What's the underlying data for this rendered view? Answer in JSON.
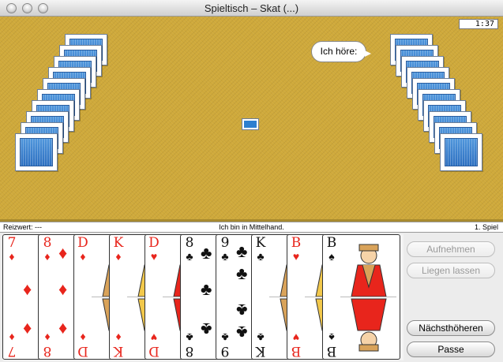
{
  "window": {
    "title": "Spieltisch – Skat (...)"
  },
  "timer": "1:37",
  "speech_bubble": "Ich höre:",
  "status": {
    "left": "Reizwert: ---",
    "center": "Ich bin in Mittelhand.",
    "right": "1. Spiel"
  },
  "hand": [
    {
      "rank": "7",
      "suit": "♦",
      "color": "red"
    },
    {
      "rank": "8",
      "suit": "♦",
      "color": "red"
    },
    {
      "rank": "D",
      "suit": "♦",
      "color": "red"
    },
    {
      "rank": "K",
      "suit": "♦",
      "color": "red"
    },
    {
      "rank": "D",
      "suit": "♥",
      "color": "red"
    },
    {
      "rank": "8",
      "suit": "♣",
      "color": "black"
    },
    {
      "rank": "9",
      "suit": "♣",
      "color": "black"
    },
    {
      "rank": "K",
      "suit": "♣",
      "color": "black"
    },
    {
      "rank": "B",
      "suit": "♥",
      "color": "red"
    },
    {
      "rank": "B",
      "suit": "♠",
      "color": "black"
    }
  ],
  "buttons": {
    "pickup": "Aufnehmen",
    "leave": "Liegen lassen",
    "next_higher": "Nächsthöheren",
    "pass": "Passe"
  },
  "colors": {
    "felt": "#cfa93a",
    "card_back": "#2c6fc0",
    "red_suit": "#e8251c"
  }
}
